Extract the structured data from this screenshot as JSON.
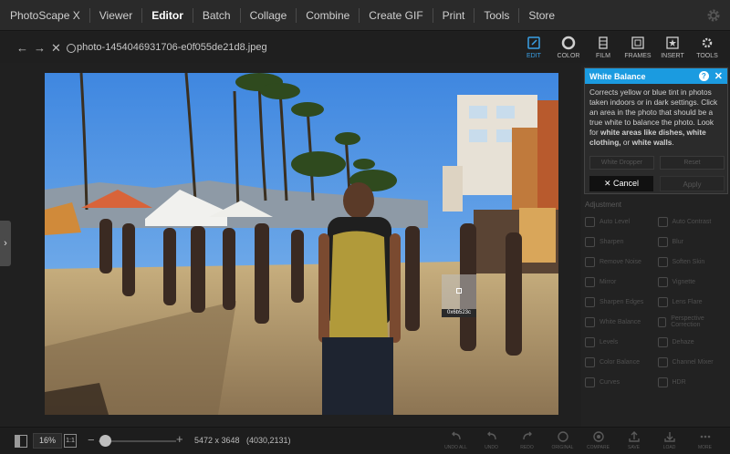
{
  "menu": {
    "items": [
      "PhotoScape X",
      "Viewer",
      "Editor",
      "Batch",
      "Collage",
      "Combine",
      "Create GIF",
      "Print",
      "Tools",
      "Store"
    ],
    "active": "Editor"
  },
  "toolbar": {
    "filename": "photo-1454046931706-e0f055de21d8.jpeg",
    "tools": [
      {
        "label": "EDIT",
        "icon": "edit-icon",
        "active": true
      },
      {
        "label": "COLOR",
        "icon": "color-icon",
        "active": false
      },
      {
        "label": "FILM",
        "icon": "film-icon",
        "active": false
      },
      {
        "label": "FRAMES",
        "icon": "frames-icon",
        "active": false
      },
      {
        "label": "INSERT",
        "icon": "insert-icon",
        "active": false
      },
      {
        "label": "TOOLS",
        "icon": "tools-icon",
        "active": false
      }
    ]
  },
  "picker": {
    "hex": "0x6b523c"
  },
  "white_balance": {
    "title": "White Balance",
    "description_1": "Corrects yellow or blue tint in photos taken indoors or in dark settings. Click an area in the photo that should be a true white to balance the photo. Look for ",
    "description_bold_1": "white areas like dishes, white clothing,",
    "description_2": " or ",
    "description_bold_2": "white walls",
    "description_3": ".",
    "btn_picker": "White Dropper",
    "btn_reset": "Reset",
    "cancel_label": "Cancel",
    "apply_label": "Apply"
  },
  "adjustments": {
    "header": "Adjustment",
    "items": [
      "Auto Level",
      "Auto Contrast",
      "Sharpen",
      "Blur",
      "Remove Noise",
      "Soften Skin",
      "Mirror",
      "Vignette",
      "Sharpen Edges",
      "Lens Flare",
      "White Balance",
      "Perspective Correction",
      "Levels",
      "Dehaze",
      "Color Balance",
      "Channel Mixer",
      "Curves",
      "HDR"
    ]
  },
  "bottom": {
    "zoom": "16%",
    "one_to_one": "1:1",
    "zoom_level": 0.16,
    "dimensions": "5472 x 3648",
    "coordinates": "(4030,2131)",
    "actions": [
      "UNDO ALL",
      "UNDO",
      "REDO",
      "ORIGINAL",
      "COMPARE",
      "SAVE",
      "LOAD",
      "MORE"
    ]
  }
}
